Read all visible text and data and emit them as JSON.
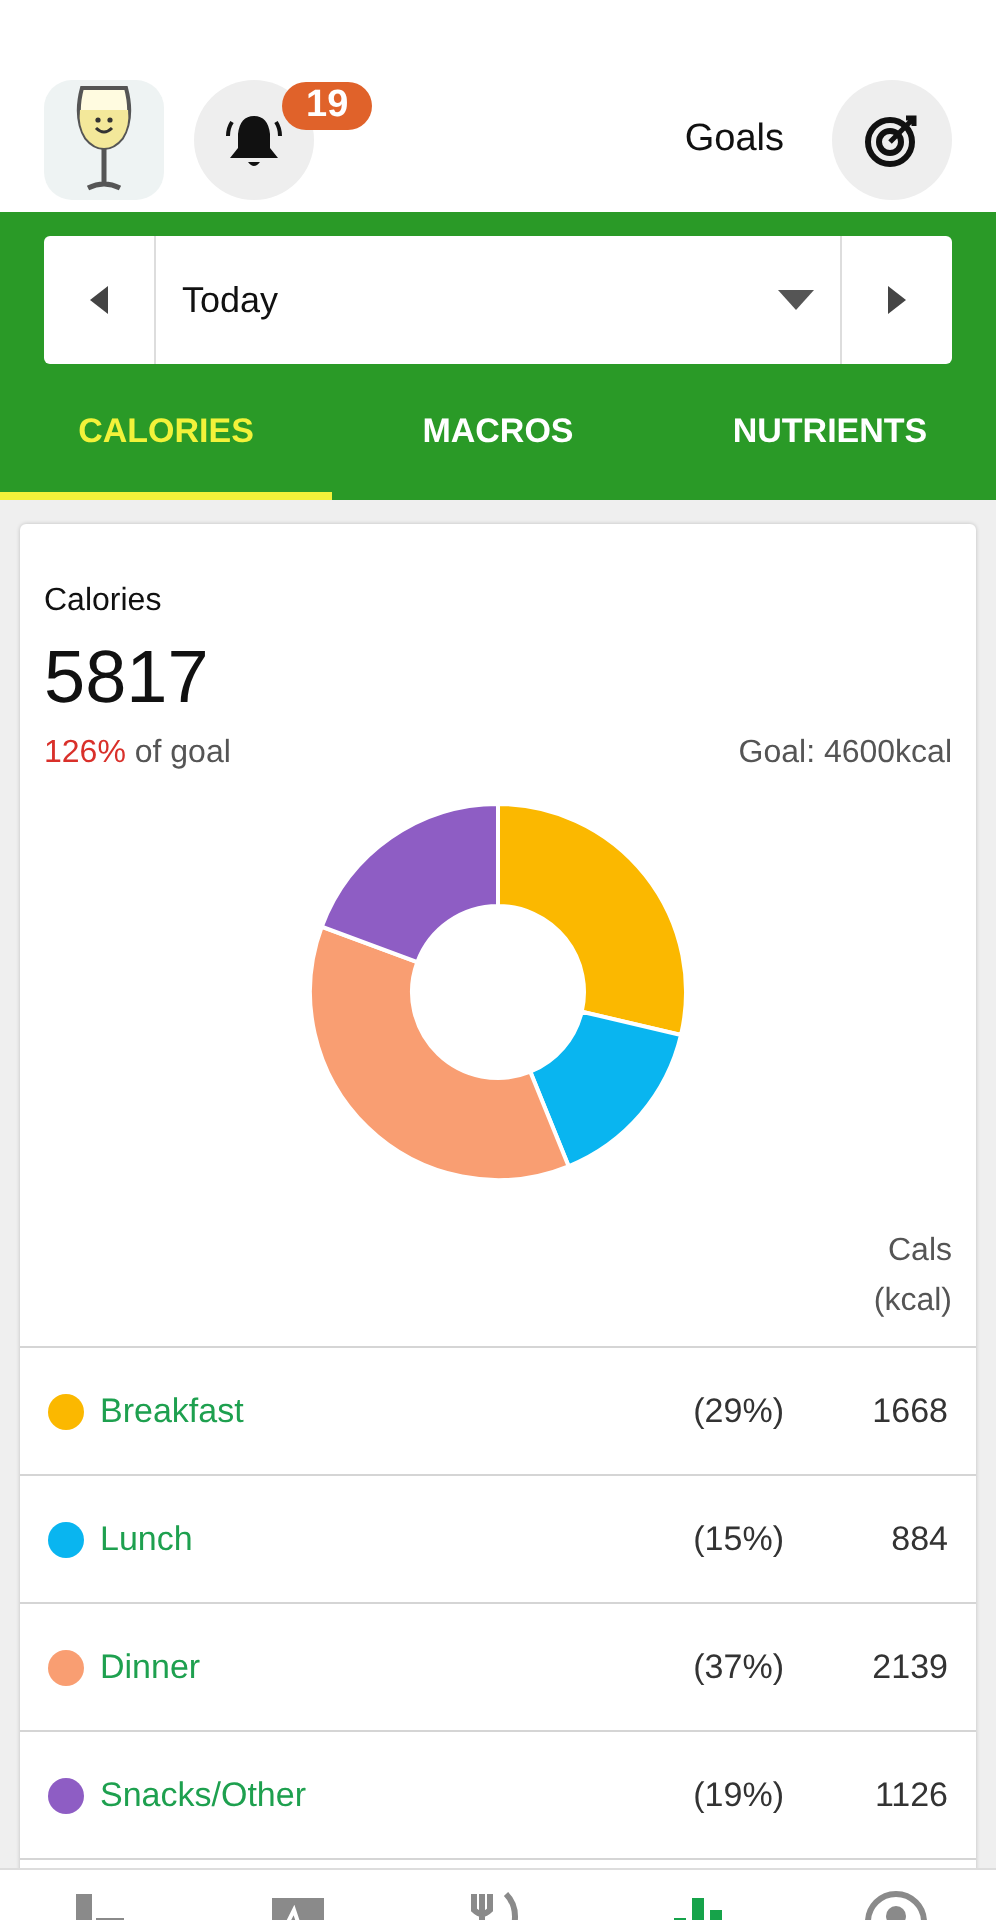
{
  "header": {
    "notification_count": "19",
    "goals_label": "Goals"
  },
  "date_selector": {
    "value": "Today"
  },
  "tabs": [
    {
      "label": "CALORIES",
      "selected": true
    },
    {
      "label": "MACROS",
      "selected": false
    },
    {
      "label": "NUTRIENTS",
      "selected": false
    }
  ],
  "summary": {
    "title": "Calories",
    "total": "5817",
    "percent": "126%",
    "percent_suffix": "of goal",
    "goal": "Goal: 4600kcal"
  },
  "table": {
    "column_header": [
      "Cals",
      "(kcal)"
    ],
    "rows": [
      {
        "meal": "Breakfast",
        "percent": "(29%)",
        "calories": "1668",
        "color": "#fbb800"
      },
      {
        "meal": "Lunch",
        "percent": "(15%)",
        "calories": "884",
        "color": "#09b5f0"
      },
      {
        "meal": "Dinner",
        "percent": "(37%)",
        "calories": "2139",
        "color": "#f99e72"
      },
      {
        "meal": "Snacks/Other",
        "percent": "(19%)",
        "calories": "1126",
        "color": "#8e5dc4"
      }
    ]
  },
  "bottom_nav": [
    {
      "kind": "dashboard",
      "selected": false
    },
    {
      "kind": "diary",
      "selected": false
    },
    {
      "kind": "food",
      "selected": false
    },
    {
      "kind": "progress",
      "selected": true
    },
    {
      "kind": "profile",
      "selected": false
    }
  ]
}
